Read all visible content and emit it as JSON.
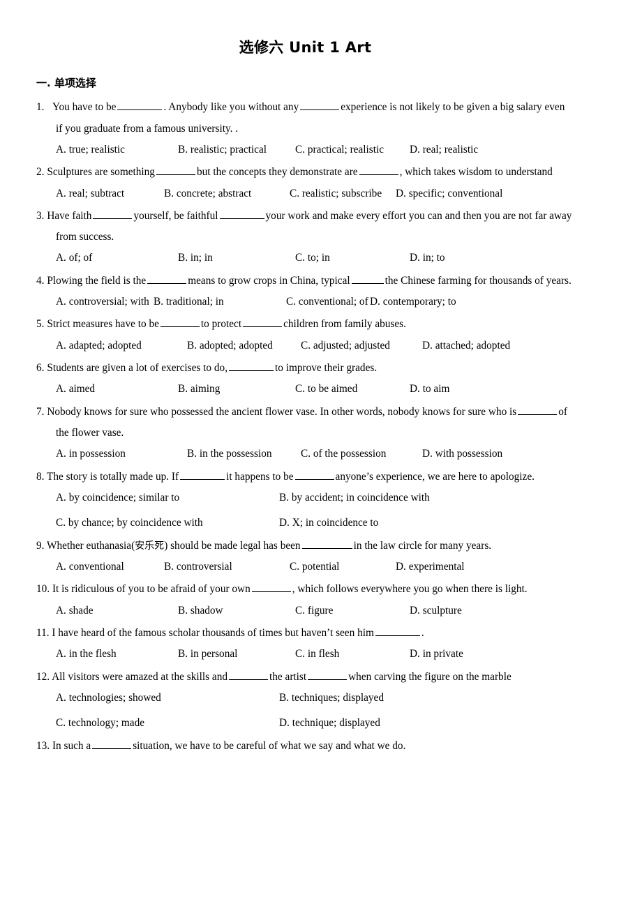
{
  "document": {
    "title": "选修六 Unit 1 Art",
    "section_heading": "一. 单项选择"
  },
  "questions": [
    {
      "number": "1.",
      "hanging": true,
      "text_parts": [
        "You have to be",
        "BLANK_LG",
        ". Anybody like you without any",
        "BLANK_MD",
        "experience is not likely to be given a big salary even"
      ],
      "stem_line1": "You have to be",
      "stem_line1b": ". Anybody like you without any",
      "stem_line1c": "experience is not likely to be given a big salary even",
      "stem_line2": "if you graduate from a famous university. .",
      "options": [
        "A. true; realistic",
        "B. realistic; practical",
        "C. practical; realistic",
        "D. real; realistic"
      ]
    },
    {
      "number": "2.",
      "stem_a": "Sculptures are something",
      "stem_b": "but the concepts they demonstrate are",
      "stem_c": ", which takes wisdom to understand",
      "options": [
        "A. real; subtract",
        "B. concrete; abstract",
        "C. realistic; subscribe",
        "D. specific; conventional"
      ]
    },
    {
      "number": "3.",
      "stem_a": "Have faith",
      "stem_b": "yourself, be faithful",
      "stem_c": "your work and make every effort you can and then you are not far away",
      "stem_line2": "from success.",
      "options": [
        "A. of; of",
        "B. in; in",
        "C. to; in",
        "D. in; to"
      ]
    },
    {
      "number": "4.",
      "stem_a": "Plowing the field is the",
      "stem_b": "means to grow crops in China, typical",
      "stem_c": "the Chinese farming for thousands of years.",
      "options": [
        "A. controversial; with",
        "B. traditional; in",
        "C. conventional; of",
        "D. contemporary; to"
      ]
    },
    {
      "number": "5.",
      "stem_a": "Strict measures have to be",
      "stem_b": "to protect",
      "stem_c": "children from family abuses.",
      "options": [
        "A. adapted; adopted",
        "B. adopted; adopted",
        "C. adjusted; adjusted",
        "D. attached; adopted"
      ]
    },
    {
      "number": "6.",
      "stem_a": "Students are given a lot of exercises to do,",
      "stem_b": "to improve their grades.",
      "options": [
        "A. aimed",
        "B. aiming",
        "C. to be aimed",
        "D. to aim"
      ]
    },
    {
      "number": "7.",
      "stem_a": "Nobody knows for sure who possessed the ancient flower vase. In other words, nobody knows for sure who is",
      "stem_b": "of",
      "stem_line2": "the flower vase.",
      "options": [
        "A. in possession",
        "B. in the possession",
        "C. of the possession",
        "D. with possession"
      ]
    },
    {
      "number": "8.",
      "stem_a": "The story is totally made up. If",
      "stem_b": "it happens to be",
      "stem_c": "anyone’s experience, we are here to apologize.",
      "two_column": true,
      "options": [
        "A. by coincidence; similar to",
        "B. by accident; in coincidence with",
        "C. by chance; by coincidence with",
        "D. X; in coincidence to"
      ]
    },
    {
      "number": "9.",
      "stem_a": "Whether euthanasia(",
      "stem_cjk": "安乐死",
      "stem_b": ") should be made legal has been",
      "stem_c": "in the law circle for many years.",
      "options": [
        "A. conventional",
        "B. controversial",
        "C. potential",
        "D. experimental"
      ]
    },
    {
      "number": "10.",
      "stem_a": "It is ridiculous of you to be afraid of your own",
      "stem_b": ", which follows everywhere you go when there is light.",
      "options": [
        "A. shade",
        "B. shadow",
        "C. figure",
        "D. sculpture"
      ]
    },
    {
      "number": "11.",
      "stem_a": "I have heard of the famous scholar thousands of times but haven’t seen him",
      "stem_b": ".",
      "options": [
        "A. in the flesh",
        "B. in personal",
        "C. in flesh",
        "D. in private"
      ]
    },
    {
      "number": "12.",
      "stem_a": "All visitors were amazed at the skills and",
      "stem_b": "the artist",
      "stem_c": "when carving the figure on the marble",
      "two_column": true,
      "options": [
        "A. technologies; showed",
        "B. techniques; displayed",
        "C. technology; made",
        "D. technique; displayed"
      ]
    },
    {
      "number": "13.",
      "stem_a": "In such a",
      "stem_b": "situation, we have to be careful of what we say and what we do.",
      "options": []
    }
  ]
}
